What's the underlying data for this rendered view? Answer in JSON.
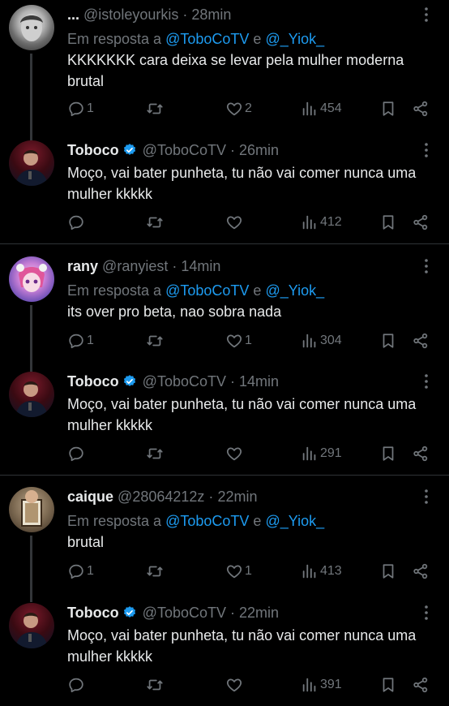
{
  "reply_prefix": "Em resposta a",
  "reply_and": "e",
  "sep": "·",
  "tweets": [
    {
      "name": "...",
      "handle": "@istoleyourkis",
      "time": "28min",
      "reply_to": [
        "@ToboCoTV",
        "@_Yiok_"
      ],
      "text": "KKKKKKK cara deixa se levar pela mulher moderna brutal",
      "replies": "1",
      "retweets": "",
      "likes": "2",
      "views": "454"
    },
    {
      "name": "Toboco",
      "handle": "@ToboCoTV",
      "time": "26min",
      "text": "Moço, vai bater punheta, tu não vai comer nunca uma mulher kkkkk",
      "replies": "",
      "retweets": "",
      "likes": "",
      "views": "412"
    },
    {
      "name": "rany",
      "handle": "@ranyiest",
      "time": "14min",
      "reply_to": [
        "@ToboCoTV",
        "@_Yiok_"
      ],
      "text": "its over pro beta, nao sobra nada",
      "replies": "1",
      "retweets": "",
      "likes": "1",
      "views": "304"
    },
    {
      "name": "Toboco",
      "handle": "@ToboCoTV",
      "time": "14min",
      "text": "Moço, vai bater punheta, tu não vai comer nunca uma mulher kkkkk",
      "replies": "",
      "retweets": "",
      "likes": "",
      "views": "291"
    },
    {
      "name": "caique",
      "handle": "@28064212z",
      "time": "22min",
      "reply_to": [
        "@ToboCoTV",
        "@_Yiok_"
      ],
      "text": "brutal",
      "replies": "1",
      "retweets": "",
      "likes": "1",
      "views": "413"
    },
    {
      "name": "Toboco",
      "handle": "@ToboCoTV",
      "time": "22min",
      "text": "Moço, vai bater punheta, tu não vai comer nunca uma mulher kkkkk",
      "replies": "",
      "retweets": "",
      "likes": "",
      "views": "391"
    }
  ],
  "colors": {
    "bg": "#000000",
    "text": "#e7e9ea",
    "muted": "#71767b",
    "accent": "#1d9bf0",
    "divider": "#2f3336"
  }
}
